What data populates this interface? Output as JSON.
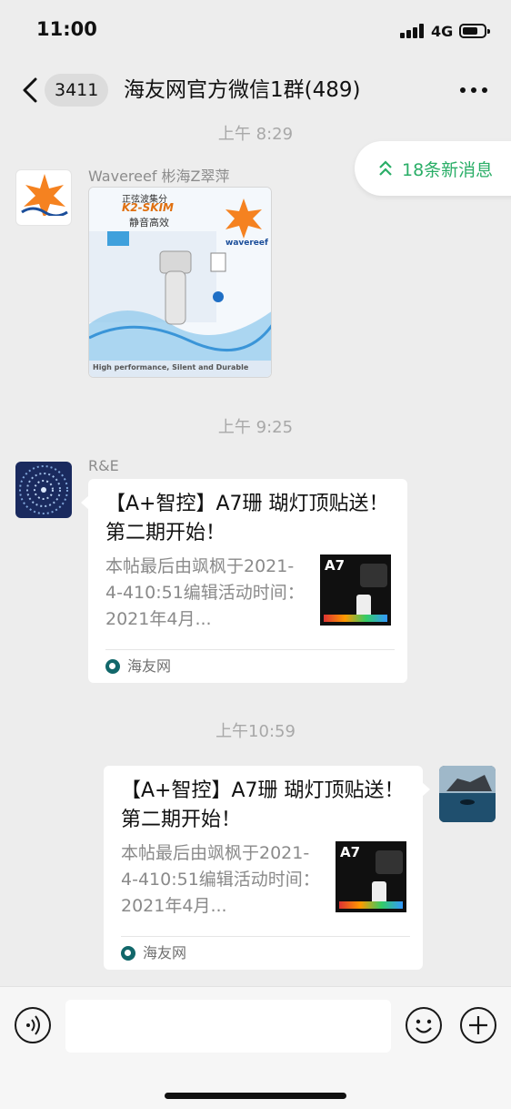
{
  "status_bar": {
    "time": "11:00",
    "network": "4G"
  },
  "nav": {
    "unread_count": "3411",
    "title": "海友网官方微信1群(489)"
  },
  "new_messages": {
    "label": "18条新消息"
  },
  "messages": [
    {
      "timestamp": "上午 8:29",
      "sender": "Wavereef 彬海Z翠萍",
      "avatar": "wavereef-logo",
      "type": "image",
      "image_texts": {
        "headline": "正弦波集分",
        "product": "K2-SKIM",
        "slogan": "静音高效",
        "brand": "wavereef",
        "footer": "High performance, Silent and Durable"
      }
    },
    {
      "timestamp": "上午 9:25",
      "sender": "R&E",
      "avatar": "blue-pattern",
      "type": "link",
      "title": "【A+智控】A7珊 瑚灯顶贴送！第二期开始！",
      "description": "本帖最后由飒枫于2021-4-410:51编辑活动时间：2021年4月...",
      "thumb_label": "A7",
      "source": "海友网"
    },
    {
      "timestamp": "上午10:59",
      "sender": "",
      "avatar": "ocean-photo",
      "type": "link",
      "own": true,
      "title": "【A+智控】A7珊 瑚灯顶贴送！第二期开始！",
      "description": "本帖最后由飒枫于2021-4-410:51编辑活动时间：2021年4月...",
      "thumb_label": "A7",
      "source": "海友网"
    }
  ],
  "input_bar": {
    "text_value": "",
    "voice_icon": "voice-icon",
    "emoji_icon": "emoji-icon",
    "plus_icon": "plus-icon"
  },
  "colors": {
    "accent": "#2aae67",
    "background": "#ededed",
    "bubble": "#ffffff",
    "timestamp": "#a8a8a8"
  }
}
